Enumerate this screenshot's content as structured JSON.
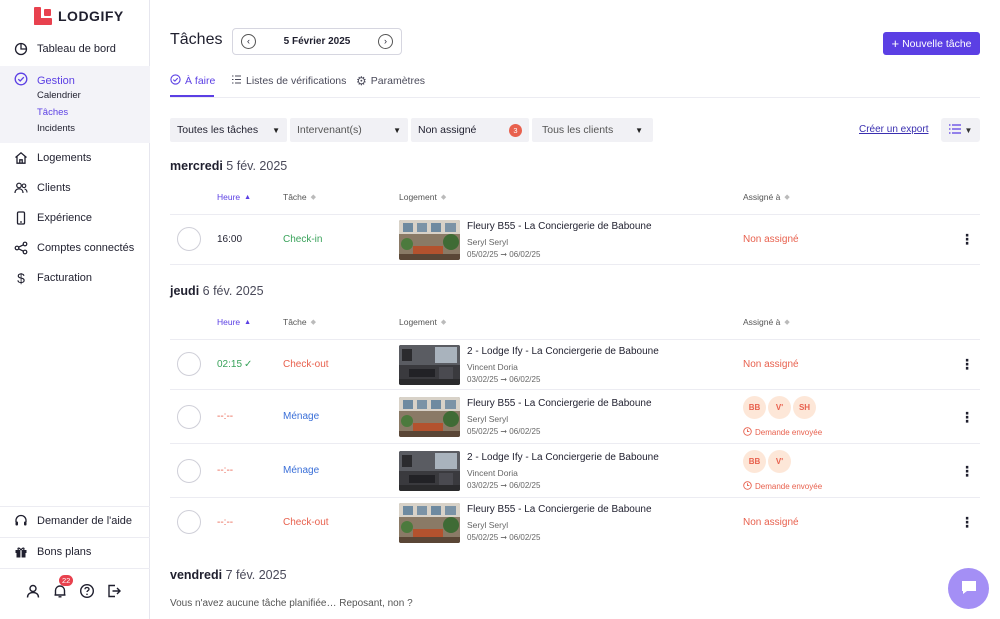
{
  "brand": {
    "name": "LODGIFY"
  },
  "sidebar": {
    "dashboard": "Tableau de bord",
    "gestion": "Gestion",
    "sub": [
      "Calendrier",
      "Tâches",
      "Incidents"
    ],
    "items": [
      "Logements",
      "Clients",
      "Expérience",
      "Comptes connectés",
      "Facturation"
    ],
    "help": "Demander de l'aide",
    "deals": "Bons plans",
    "notifications_count": "22"
  },
  "header": {
    "title": "Tâches",
    "date": "5 Février 2025",
    "prev_icon": "chevron-left-icon",
    "next_icon": "chevron-right-icon",
    "new_task": "Nouvelle tâche"
  },
  "tabs": [
    {
      "label": "À faire",
      "icon": "check-circle-icon"
    },
    {
      "label": "Listes de vérifications",
      "icon": "checklist-icon"
    },
    {
      "label": "Paramètres",
      "icon": "gear-icon"
    }
  ],
  "filters": {
    "tasks": "Toutes les tâches",
    "staff": "Intervenant(s)",
    "unassigned": "Non assigné",
    "unassigned_count": "3",
    "clients": "Tous les clients",
    "export": "Créer un export"
  },
  "columns": {
    "time": "Heure",
    "task": "Tâche",
    "property": "Logement",
    "assigned": "Assigné à"
  },
  "days": [
    {
      "weekday": "mercredi",
      "date": "5 fév. 2025"
    },
    {
      "weekday": "jeudi",
      "date": "6 fév. 2025"
    },
    {
      "weekday": "vendredi",
      "date": "7 fév. 2025"
    }
  ],
  "rows": [
    {
      "time": "16:00",
      "task": "Check-in",
      "property": "Fleury B55 - La Conciergerie de Baboune",
      "guest": "Seryl Seryl",
      "dates": "05/02/25 ➞ 06/02/25",
      "assigned": "Non assigné"
    },
    {
      "time": "02:15",
      "task": "Check-out",
      "property": "2 - Lodge Ify - La Conciergerie de Baboune",
      "guest": "Vincent Doria",
      "dates": "03/02/25 ➞ 06/02/25",
      "assigned": "Non assigné"
    },
    {
      "time": "--:--",
      "task": "Ménage",
      "property": "Fleury B55 - La Conciergerie de Baboune",
      "guest": "Seryl Seryl",
      "dates": "05/02/25 ➞ 06/02/25",
      "avatars": [
        "BB",
        "V'",
        "SH"
      ],
      "status": "Demande envoyée"
    },
    {
      "time": "--:--",
      "task": "Ménage",
      "property": "2 - Lodge Ify - La Conciergerie de Baboune",
      "guest": "Vincent Doria",
      "dates": "03/02/25 ➞ 06/02/25",
      "avatars": [
        "BB",
        "V'"
      ],
      "status": "Demande envoyée"
    },
    {
      "time": "--:--",
      "task": "Check-out",
      "property": "Fleury B55 - La Conciergerie de Baboune",
      "guest": "Seryl Seryl",
      "dates": "05/02/25 ➞ 06/02/25",
      "assigned": "Non assigné"
    }
  ],
  "empty_message": "Vous n'avez aucune tâche planifiée… Reposant, non ?",
  "colors": {
    "accent": "#5b3fe4",
    "danger": "#e8614e",
    "success": "#3aa35b",
    "info": "#3a6fd8"
  }
}
